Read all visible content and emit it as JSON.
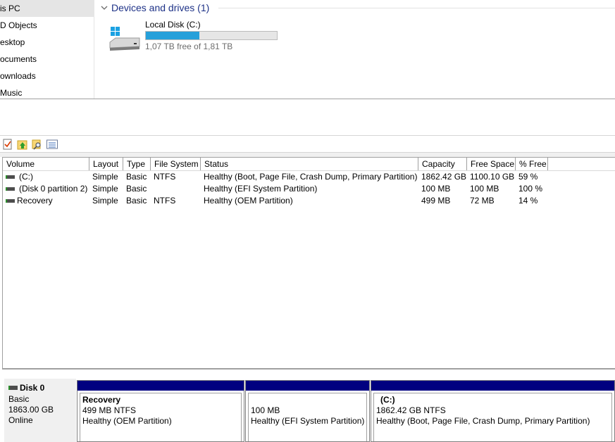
{
  "nav": {
    "items": [
      {
        "label": "is PC",
        "selected": true
      },
      {
        "label": "D Objects"
      },
      {
        "label": "esktop"
      },
      {
        "label": "ocuments"
      },
      {
        "label": "ownloads"
      },
      {
        "label": "Music"
      }
    ]
  },
  "drives": {
    "header": "Devices and drives (1)",
    "disk": {
      "name": "Local Disk (C:)",
      "free_text": "1,07 TB free of 1,81 TB",
      "used_fraction": 0.41
    }
  },
  "toolbar": {
    "icons": [
      "properties-check-icon",
      "up-folder-icon",
      "search-folder-icon",
      "view-list-icon"
    ]
  },
  "volumes": {
    "columns": [
      "Volume",
      "Layout",
      "Type",
      "File System",
      "Status",
      "Capacity",
      "Free Space",
      "% Free"
    ],
    "rows": [
      {
        "volume": "(C:)",
        "layout": "Simple",
        "type": "Basic",
        "fs": "NTFS",
        "status": "Healthy (Boot, Page File, Crash Dump, Primary Partition)",
        "capacity": "1862.42 GB",
        "free": "1100.10 GB",
        "pct": "59 %"
      },
      {
        "volume": "(Disk 0 partition 2)",
        "layout": "Simple",
        "type": "Basic",
        "fs": "",
        "status": "Healthy (EFI System Partition)",
        "capacity": "100 MB",
        "free": "100 MB",
        "pct": "100 %"
      },
      {
        "volume": "Recovery",
        "layout": "Simple",
        "type": "Basic",
        "fs": "NTFS",
        "status": "Healthy (OEM Partition)",
        "capacity": "499 MB",
        "free": "72 MB",
        "pct": "14 %"
      }
    ]
  },
  "diskmap": {
    "disk": {
      "name": "Disk 0",
      "kind": "Basic",
      "size": "1863.00 GB",
      "state": "Online"
    },
    "partitions": [
      {
        "name": "Recovery",
        "size": "499 MB NTFS",
        "status": "Healthy (OEM Partition)"
      },
      {
        "name": "",
        "size": "100 MB",
        "status": "Healthy (EFI System Partition)"
      },
      {
        "name": "(C:)",
        "size": "1862.42 GB NTFS",
        "status": "Healthy (Boot, Page File, Crash Dump, Primary Partition)"
      }
    ]
  },
  "colors": {
    "accent_blue": "#1e3287",
    "bar_fill": "#26a0da",
    "partition_header": "#000080"
  }
}
